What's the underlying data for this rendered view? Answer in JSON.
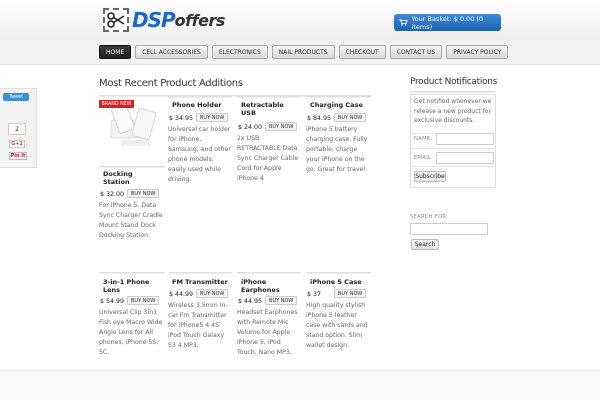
{
  "brand": {
    "dsp": "DSP",
    "offers": "offers"
  },
  "basket": {
    "label": "Your Basket: $ 0.00 (0 items)",
    "icon": "cart-icon"
  },
  "nav": [
    "HOME",
    "CELL ACCESSORIES",
    "ELECTRONICS",
    "NAIL PRODUCTS",
    "CHECKOUT",
    "CONTACT US",
    "PRIVACY POLICY"
  ],
  "social": {
    "tweet": "Tweet",
    "count": "2",
    "gplus": "G+1",
    "pinit": "Pin it"
  },
  "main": {
    "title": "Most Recent Product Additions",
    "badge": "BRAND NEW",
    "buy_label": "BUY NOW",
    "products": [
      {
        "name": "Phone Holder",
        "price": "$ 34.95",
        "desc": "Universal car holder for iPhone, Samsung, and other phone models, easily used while driving."
      },
      {
        "name": "Retractable USB",
        "price": "$ 24.00",
        "desc": "2x USB RETRACTABLE Data Sync Charger Cable Cord for Apple iPhone 4"
      },
      {
        "name": "Charging Case",
        "price": "$ 84.95",
        "desc": "iPhone 5 battery charging case. Fully portable, charge your iPhone on the go. Great for travel."
      },
      {
        "name": "Docking Station",
        "price": "$ 32.00",
        "desc": "For iPhone 5. Data Sync Charger Cradle Mount Stand Dock Docking Station."
      },
      {
        "name": "3-in-1 Phone Lens",
        "price": "$ 54.99",
        "desc": "Universal Clip 3in1 Fish eye Macro Wide Angle Lens for All phones, iPhone 5S, 5C."
      },
      {
        "name": "FM Transmitter",
        "price": "$ 44.99",
        "desc": "Wireless 3.5mm In-car Fm Transmitter for iPhone5 4 4S iPod Touch Galaxy S3 4 MP3."
      },
      {
        "name": "iPhone Earphones",
        "price": "$ 44.95",
        "desc": "Headset Earphones with Remote Mic Volume for Apple iPhone 5, iPod Touch, Nano MP3."
      },
      {
        "name": "iPhone 5 Case",
        "price": "$ 37",
        "desc": "High quality stylish iPhone 5 leather case with cards and stand option. Slim wallet design."
      }
    ]
  },
  "sidebar": {
    "title": "Product Notifications",
    "text": "Get notified whenever we release a new product for exclusive discounts.",
    "name_label": "NAME:",
    "email_label": "EMAIL:",
    "subscribe": "Subscribe",
    "search_label": "SEARCH FOR:",
    "search_btn": "Search"
  },
  "colors": {
    "accent": "#1e62b3",
    "badge": "#d62222",
    "nav_active": "#1f1f1f"
  }
}
